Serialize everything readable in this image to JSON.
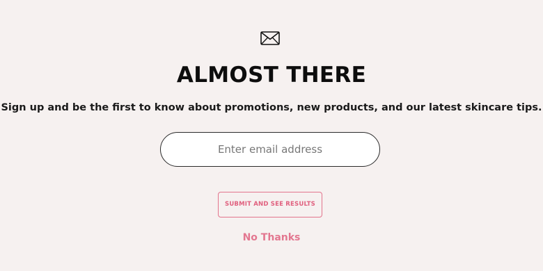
{
  "popup": {
    "icon": "envelope-icon",
    "title": "ALMOST THERE",
    "subtitle": "Sign up and be the first to know about promotions, new products, and our latest skincare tips.",
    "email_placeholder": "Enter email address",
    "email_value": "",
    "submit_label": "SUBMIT AND SEE RESULTS",
    "dismiss_label": "No Thanks"
  },
  "colors": {
    "background": "#f6f1f0",
    "accent": "#e37790",
    "text": "#111111",
    "input_border": "#2a2a2a"
  }
}
